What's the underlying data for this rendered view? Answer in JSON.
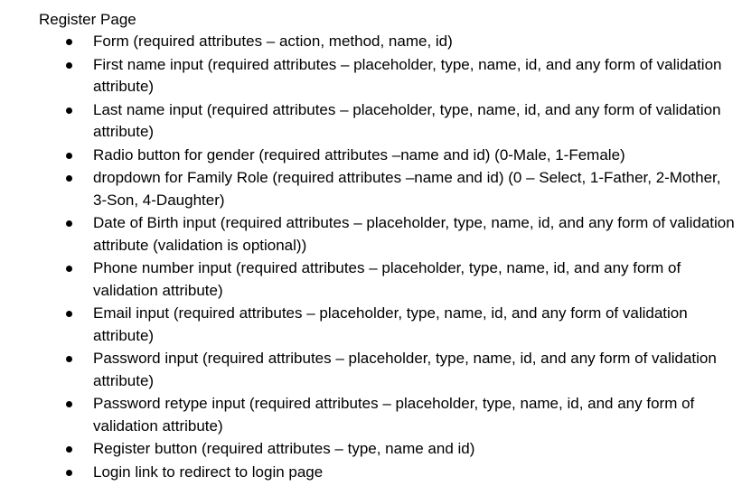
{
  "document": {
    "title": "Register Page",
    "items": [
      "Form (required attributes – action, method, name, id)",
      "First name input (required attributes – placeholder, type, name, id, and any form of validation attribute)",
      "Last name input (required attributes – placeholder, type, name, id, and any form of validation attribute)",
      "Radio button for gender (required attributes –name and id) (0-Male, 1-Female)",
      "dropdown for Family Role (required attributes –name and id) (0 – Select, 1-Father, 2-Mother, 3-Son, 4-Daughter)",
      "Date of Birth input (required attributes – placeholder, type, name, id, and any form of validation attribute (validation is optional))",
      "Phone number input (required attributes – placeholder, type, name, id, and any form of validation attribute)",
      "Email input (required attributes – placeholder, type, name, id, and any form of validation attribute)",
      "Password input (required attributes – placeholder, type, name, id, and any form of validation attribute)",
      "Password retype input (required attributes – placeholder, type, name, id, and any form of validation attribute)",
      "Register button (required attributes – type, name and id)",
      "Login link to redirect to login page"
    ]
  }
}
